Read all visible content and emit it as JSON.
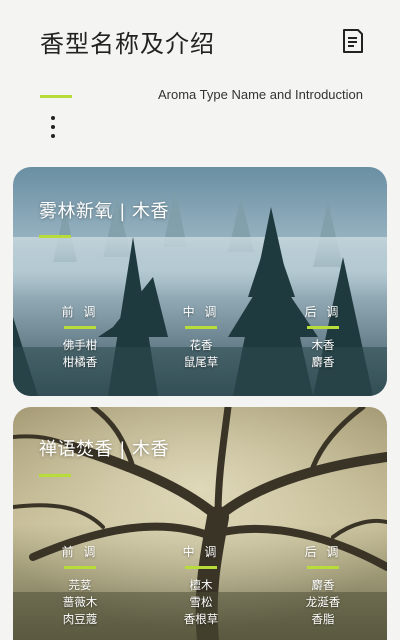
{
  "header": {
    "title": "香型名称及介绍",
    "subtitle": "Aroma Type Name and Introduction",
    "doc_icon": "document-icon",
    "more_icon": "more-vertical-icon"
  },
  "colors": {
    "accent": "#b8dc3a",
    "background": "#f4f4f3"
  },
  "cards": [
    {
      "title": "雾林新氧 | 木香",
      "notes": [
        {
          "label": "前 调",
          "items": [
            "佛手柑",
            "柑橘香"
          ]
        },
        {
          "label": "中 调",
          "items": [
            "花香",
            "鼠尾草"
          ]
        },
        {
          "label": "后 调",
          "items": [
            "木香",
            "麝香"
          ]
        }
      ]
    },
    {
      "title": "禅语焚香 | 木香",
      "notes": [
        {
          "label": "前 调",
          "items": [
            "芫荽",
            "蔷薇木",
            "肉豆蔻"
          ]
        },
        {
          "label": "中 调",
          "items": [
            "檀木",
            "雪松",
            "香根草"
          ]
        },
        {
          "label": "后 调",
          "items": [
            "麝香",
            "龙涎香",
            "香脂"
          ]
        }
      ]
    }
  ]
}
